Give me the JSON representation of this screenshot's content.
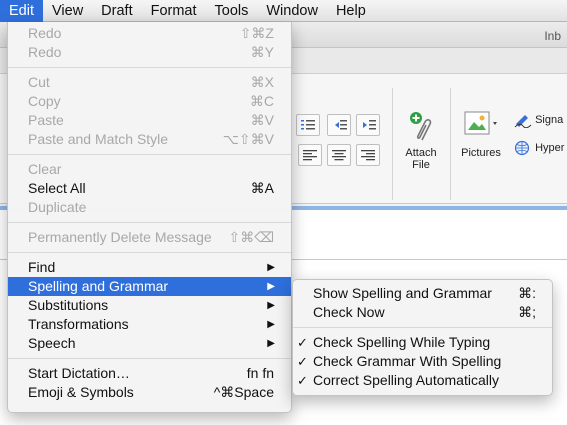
{
  "menubar": {
    "items": [
      "Edit",
      "View",
      "Draft",
      "Format",
      "Tools",
      "Window",
      "Help"
    ]
  },
  "window": {
    "title_fragment": "Inb",
    "ribbon": {
      "attach_label": "Attach\nFile",
      "attach_line1": "Attach",
      "attach_line2": "File",
      "pictures_label": "Pictures",
      "signature_label": "Signa",
      "hyperlink_label": "Hyper"
    }
  },
  "edit_menu": {
    "redo": {
      "label": "Redo",
      "shortcut": "⇧⌘Z"
    },
    "redo2": {
      "label": "Redo",
      "shortcut": "⌘Y"
    },
    "cut": {
      "label": "Cut",
      "shortcut": "⌘X"
    },
    "copy": {
      "label": "Copy",
      "shortcut": "⌘C"
    },
    "paste": {
      "label": "Paste",
      "shortcut": "⌘V"
    },
    "paste_match": {
      "label": "Paste and Match Style",
      "shortcut": "⌥⇧⌘V"
    },
    "clear": {
      "label": "Clear"
    },
    "select_all": {
      "label": "Select All",
      "shortcut": "⌘A"
    },
    "duplicate": {
      "label": "Duplicate"
    },
    "perm_delete": {
      "label": "Permanently Delete Message",
      "shortcut": "⇧⌘⌫"
    },
    "find": {
      "label": "Find"
    },
    "spelling": {
      "label": "Spelling and Grammar"
    },
    "substitutions": {
      "label": "Substitutions"
    },
    "transformations": {
      "label": "Transformations"
    },
    "speech": {
      "label": "Speech"
    },
    "dictation": {
      "label": "Start Dictation…",
      "shortcut": "fn fn"
    },
    "emoji": {
      "label": "Emoji & Symbols",
      "shortcut": "^⌘Space"
    }
  },
  "spelling_submenu": {
    "show": {
      "label": "Show Spelling and Grammar",
      "shortcut": "⌘:"
    },
    "check_now": {
      "label": "Check Now",
      "shortcut": "⌘;"
    },
    "check_typing": {
      "label": "Check Spelling While Typing",
      "checked": true
    },
    "check_grammar": {
      "label": "Check Grammar With Spelling",
      "checked": true
    },
    "correct_auto": {
      "label": "Correct Spelling Automatically",
      "checked": true
    },
    "check_glyph": "✓"
  },
  "colors": {
    "highlight": "#2f6fdc"
  }
}
